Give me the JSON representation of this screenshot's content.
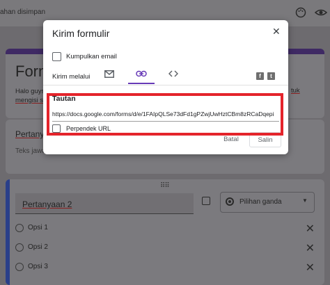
{
  "background": {
    "saved_status": "ahan disimpan",
    "form_title": "Form",
    "description_lines": [
      "Halo guys",
      "mengisi s"
    ],
    "description_link_tail": "tuk",
    "question1_label": "Pertanya",
    "answer_placeholder": "Teks jawa",
    "question2_label": "Pertanyaan 2",
    "question_type": "Pilihan ganda",
    "options": [
      "Opsi 1",
      "Opsi 2",
      "Opsi 3"
    ],
    "icons": [
      "palette-icon",
      "eye-icon",
      "image-icon",
      "drag-handle-icon",
      "radio-icon",
      "close-icon"
    ]
  },
  "dialog": {
    "title": "Kirim formulir",
    "close_label": "✕",
    "collect_email_label": "Kumpulkan email",
    "send_via_label": "Kirim melalui",
    "tabs": [
      {
        "name": "email",
        "icon": "mail-icon"
      },
      {
        "name": "link",
        "icon": "link-icon",
        "active": true
      },
      {
        "name": "embed",
        "icon": "code-icon"
      }
    ],
    "social": [
      {
        "name": "facebook",
        "glyph": "f"
      },
      {
        "name": "twitter",
        "glyph": "t"
      }
    ],
    "link_section_label": "Tautan",
    "link_url": "https://docs.google.com/forms/d/e/1FAIpQLSe73dFd1gPZwjUwHztCBm8zRCaDqepi",
    "shorten_url_label": "Perpendek URL",
    "cancel_label": "Batal",
    "copy_label": "Salin",
    "accent_color": "#673ab7",
    "highlight_color": "#e4242b"
  }
}
